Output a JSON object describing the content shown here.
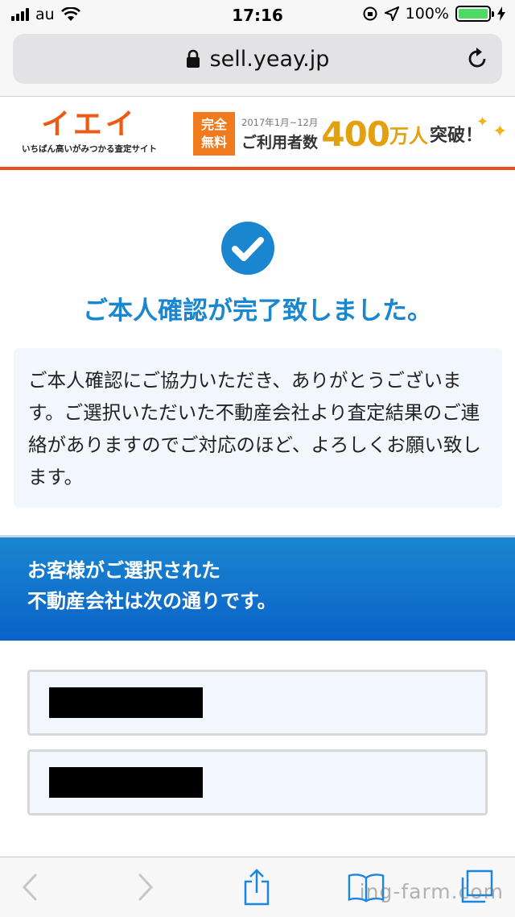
{
  "status_bar": {
    "carrier": "au",
    "time": "17:16",
    "battery_percent": "100%",
    "battery_level": 1.0,
    "battery_color": "#4cd964"
  },
  "browser": {
    "url": "sell.yeay.jp",
    "icons": [
      "lock-icon",
      "reload-icon"
    ]
  },
  "header": {
    "logo_text": "イエイ",
    "logo_tagline": "いちばん高いがみつかる査定サイト",
    "banner": {
      "free_line1": "完全",
      "free_line2": "無料",
      "period": "2017年1月~12月",
      "users_label": "ご利用者数",
      "count": "400",
      "unit": "万人",
      "breakthrough": "突破！"
    },
    "accent_color": "#e8501b"
  },
  "confirmation": {
    "icon": "check-circle-icon",
    "title": "ご本人確認が完了致しました。",
    "message": "ご本人確認にご協力いただき、ありがとうございます。ご選択いただいた不動産会社より査定結果のご連絡がありますのでご対応のほど、よろしくお願い致します。",
    "title_color": "#1a86cf"
  },
  "companies_section": {
    "heading_line1": "お客様がご選択された",
    "heading_line2": "不動産会社は次の通りです。",
    "companies": [
      {
        "name_redacted": true
      },
      {
        "name_redacted": true
      }
    ]
  },
  "toolbar": {
    "icons": [
      "back-icon",
      "forward-icon",
      "share-icon",
      "bookmarks-icon",
      "tabs-icon"
    ],
    "watermark": "ing-farm.com"
  }
}
